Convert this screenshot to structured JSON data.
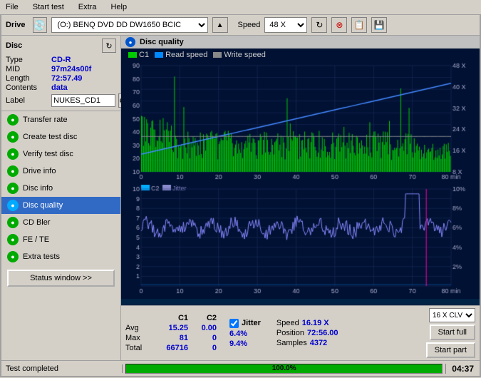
{
  "menubar": {
    "items": [
      "File",
      "Start test",
      "Extra",
      "Help"
    ]
  },
  "toolbar": {
    "drive_label": "Drive",
    "drive_value": "(O:)  BENQ DVD DD DW1650 BCIC",
    "speed_label": "Speed",
    "speed_value": "48 X"
  },
  "disc": {
    "title": "Disc",
    "type_label": "Type",
    "type_value": "CD-R",
    "mid_label": "MID",
    "mid_value": "97m24s00f",
    "length_label": "Length",
    "length_value": "72:57.49",
    "contents_label": "Contents",
    "contents_value": "data",
    "label_label": "Label",
    "label_value": "NUKES_CD1"
  },
  "nav": {
    "items": [
      {
        "label": "Transfer rate",
        "active": false
      },
      {
        "label": "Create test disc",
        "active": false
      },
      {
        "label": "Verify test disc",
        "active": false
      },
      {
        "label": "Drive info",
        "active": false
      },
      {
        "label": "Disc info",
        "active": false
      },
      {
        "label": "Disc quality",
        "active": true
      },
      {
        "label": "CD Bler",
        "active": false
      },
      {
        "label": "FE / TE",
        "active": false
      },
      {
        "label": "Extra tests",
        "active": false
      }
    ]
  },
  "status_btn": "Status window >>",
  "disc_quality": {
    "title": "Disc quality",
    "legend": {
      "c1": "C1",
      "c2": "C2",
      "read_speed": "Read speed",
      "write_speed": "Write speed"
    }
  },
  "chart1": {
    "y_max": 90,
    "y_labels": [
      90,
      80,
      70,
      60,
      50,
      40,
      30,
      20,
      10
    ],
    "x_labels": [
      0,
      10,
      20,
      30,
      40,
      50,
      60,
      70
    ],
    "x_max_label": "80 min",
    "right_labels": [
      "48 X",
      "40 X",
      "32 X",
      "24 X",
      "16 X",
      "8 X"
    ]
  },
  "chart2": {
    "y_max": 10,
    "y_labels": [
      10,
      9,
      8,
      7,
      6,
      5,
      4,
      3,
      2,
      1
    ],
    "x_labels": [
      0,
      10,
      20,
      30,
      40,
      50,
      60,
      70
    ],
    "x_max_label": "80 min",
    "right_labels": [
      "10%",
      "8%",
      "6%",
      "4%",
      "2%"
    ]
  },
  "stats": {
    "columns": {
      "c1_label": "C1",
      "c2_label": "C2"
    },
    "jitter_label": "Jitter",
    "avg_label": "Avg",
    "avg_c1": "15.25",
    "avg_c2": "0.00",
    "avg_jitter": "6.4%",
    "max_label": "Max",
    "max_c1": "81",
    "max_c2": "0",
    "max_jitter": "9.4%",
    "total_label": "Total",
    "total_c1": "66716",
    "total_c2": "0",
    "speed_label": "Speed",
    "speed_value": "16.19 X",
    "position_label": "Position",
    "position_value": "72:56.00",
    "samples_label": "Samples",
    "samples_value": "4372"
  },
  "buttons": {
    "speed_option": "16 X CLV",
    "start_full": "Start full",
    "start_part": "Start part"
  },
  "statusbar": {
    "status_text": "Test completed",
    "progress_value": 100,
    "progress_label": "100.0%",
    "time": "04:37"
  }
}
